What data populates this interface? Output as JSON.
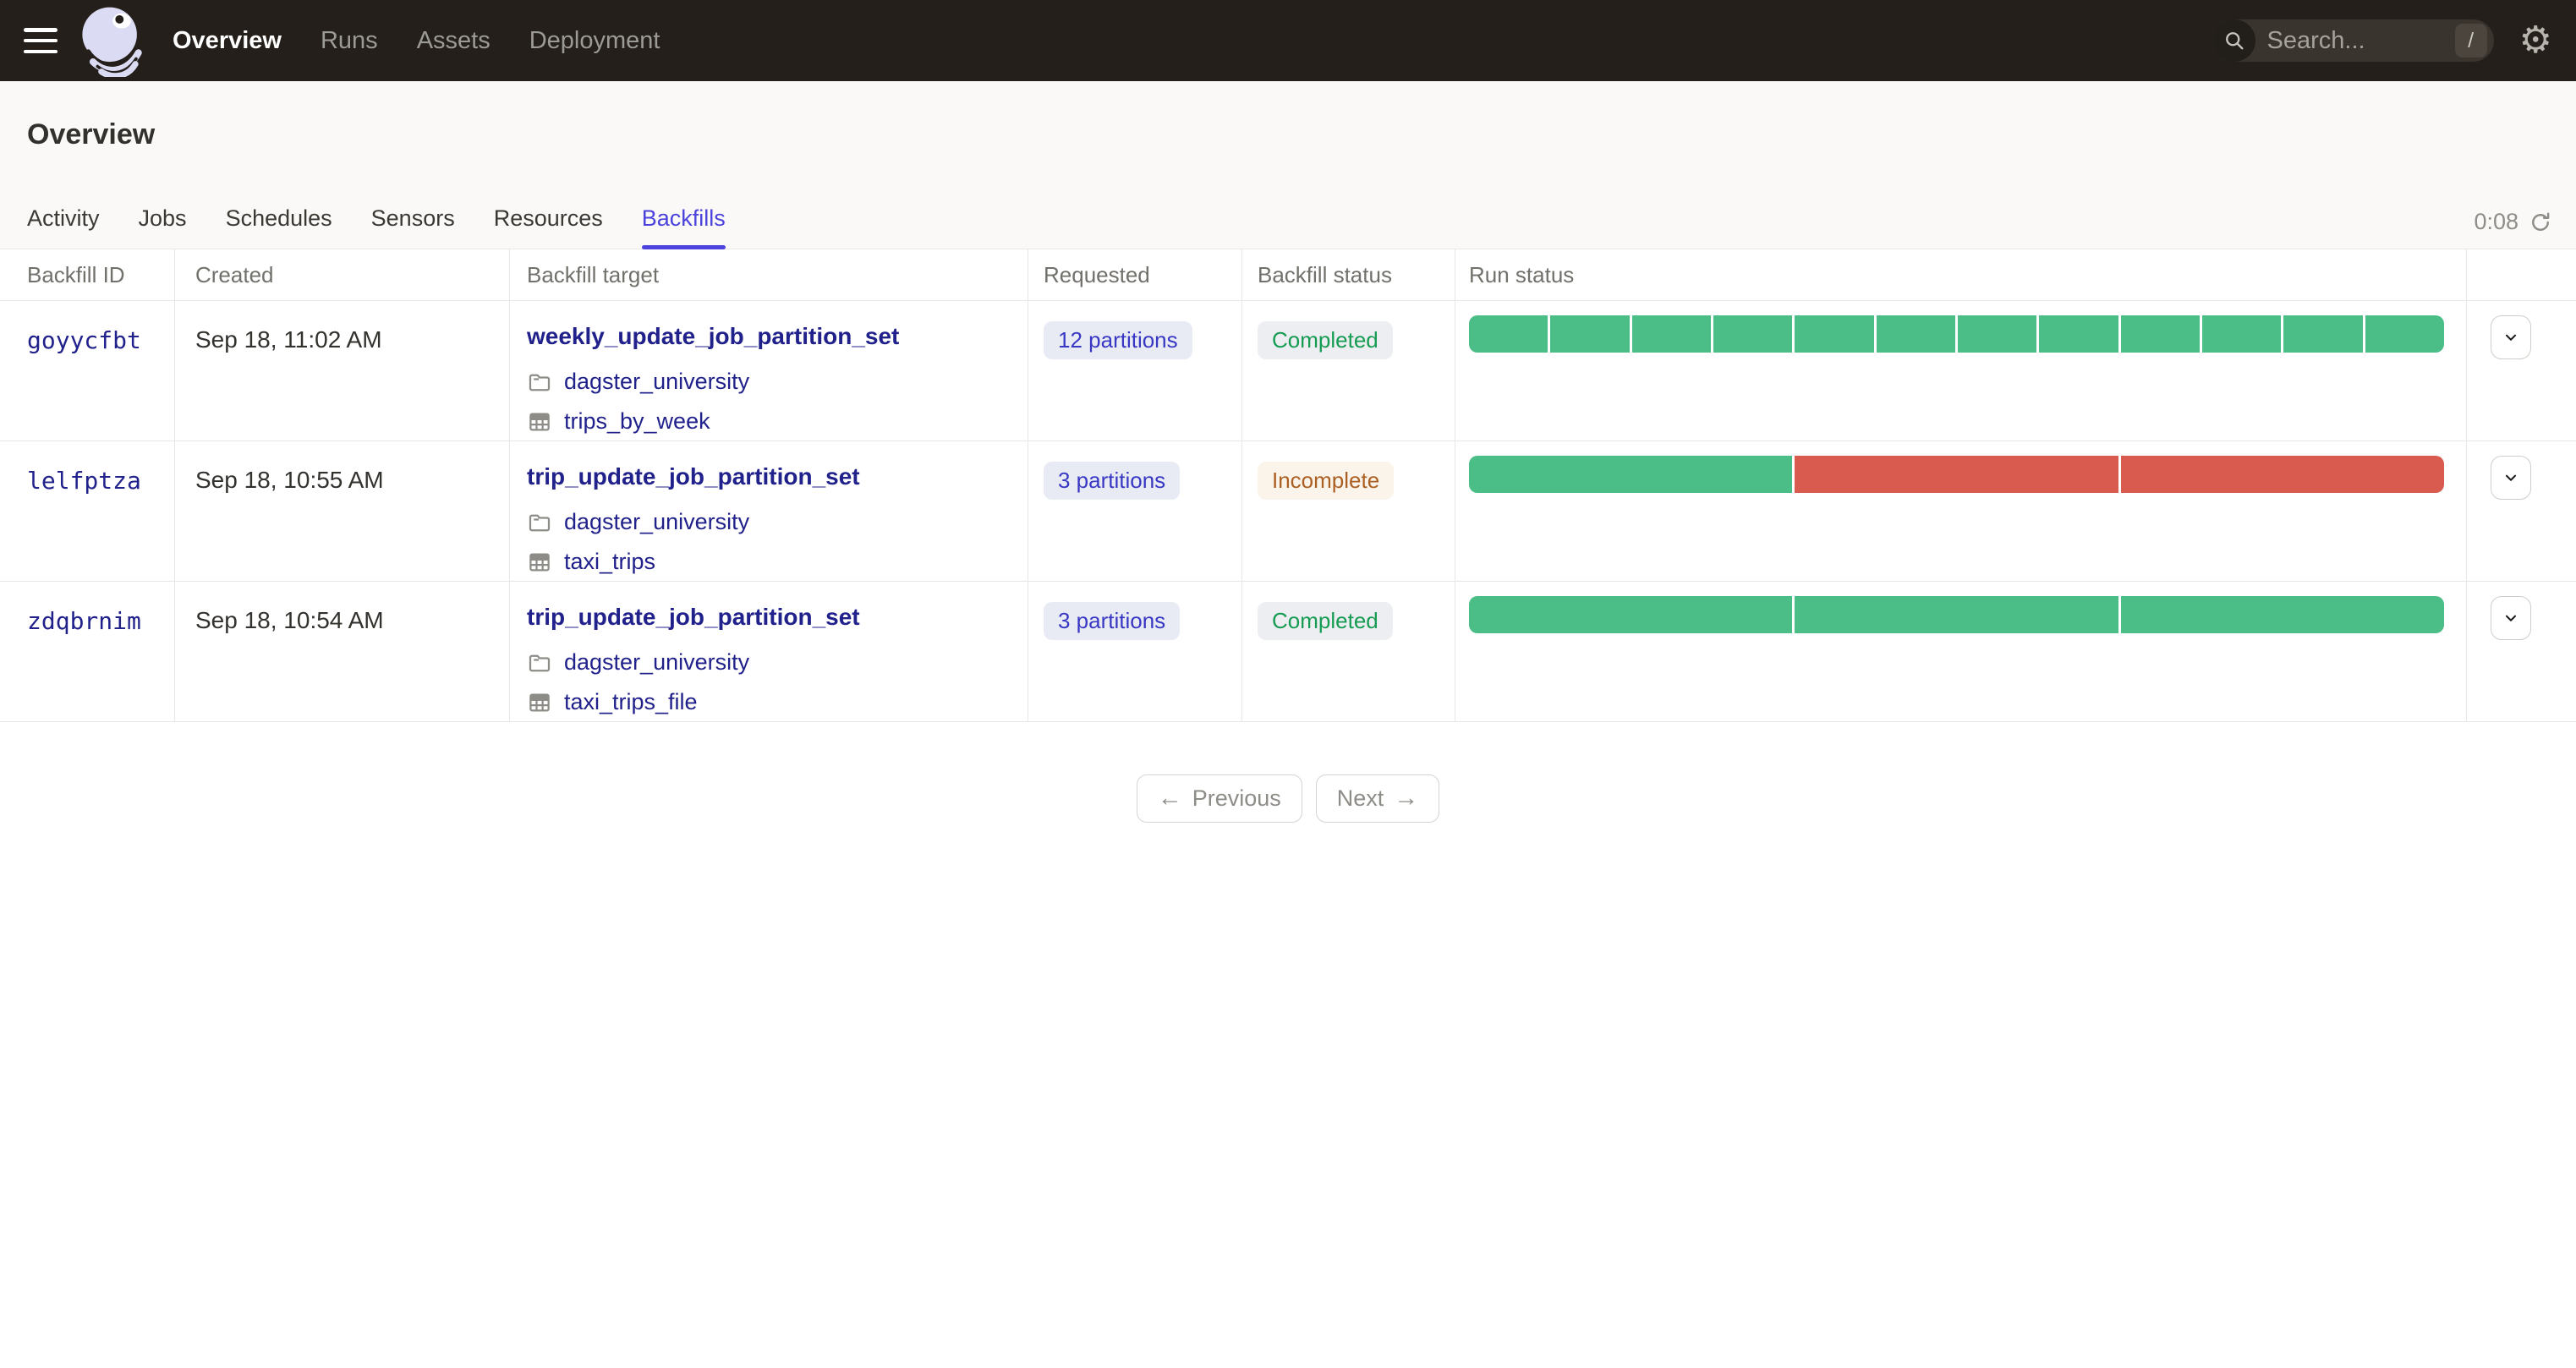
{
  "topnav": {
    "items": [
      {
        "label": "Overview",
        "active": true
      },
      {
        "label": "Runs",
        "active": false
      },
      {
        "label": "Assets",
        "active": false
      },
      {
        "label": "Deployment",
        "active": false
      }
    ],
    "search": {
      "placeholder": "Search...",
      "shortcut_key": "/"
    }
  },
  "page": {
    "title": "Overview"
  },
  "tabs": [
    {
      "label": "Activity",
      "active": false
    },
    {
      "label": "Jobs",
      "active": false
    },
    {
      "label": "Schedules",
      "active": false
    },
    {
      "label": "Sensors",
      "active": false
    },
    {
      "label": "Resources",
      "active": false
    },
    {
      "label": "Backfills",
      "active": true
    }
  ],
  "auto_refresh": {
    "countdown": "0:08"
  },
  "backfills_table": {
    "columns": [
      "Backfill ID",
      "Created",
      "Backfill target",
      "Requested",
      "Backfill status",
      "Run status"
    ],
    "rows": [
      {
        "id": "goyycfbt",
        "created": "Sep 18, 11:02 AM",
        "target_name": "weekly_update_job_partition_set",
        "code_location": "dagster_university",
        "asset": "trips_by_week",
        "requested": "12 partitions",
        "status": "Completed",
        "status_type": "completed",
        "run_segments": [
          "success",
          "success",
          "success",
          "success",
          "success",
          "success",
          "success",
          "success",
          "success",
          "success",
          "success",
          "success"
        ]
      },
      {
        "id": "lelfptza",
        "created": "Sep 18, 10:55 AM",
        "target_name": "trip_update_job_partition_set",
        "code_location": "dagster_university",
        "asset": "taxi_trips",
        "requested": "3 partitions",
        "status": "Incomplete",
        "status_type": "incomplete",
        "run_segments": [
          "success",
          "failure",
          "failure"
        ]
      },
      {
        "id": "zdqbrnim",
        "created": "Sep 18, 10:54 AM",
        "target_name": "trip_update_job_partition_set",
        "code_location": "dagster_university",
        "asset": "taxi_trips_file",
        "requested": "3 partitions",
        "status": "Completed",
        "status_type": "completed",
        "run_segments": [
          "success",
          "success",
          "success"
        ]
      }
    ]
  },
  "pagination": {
    "previous": "Previous",
    "next": "Next"
  },
  "colors": {
    "accent": "#4B43DB",
    "success_bar": "#4BBD86",
    "failure_bar": "#D95B4F",
    "link_navy": "#21218C",
    "completed_text": "#169C52",
    "incomplete_text": "#AC5F22",
    "topbar_bg": "#241F1B"
  }
}
